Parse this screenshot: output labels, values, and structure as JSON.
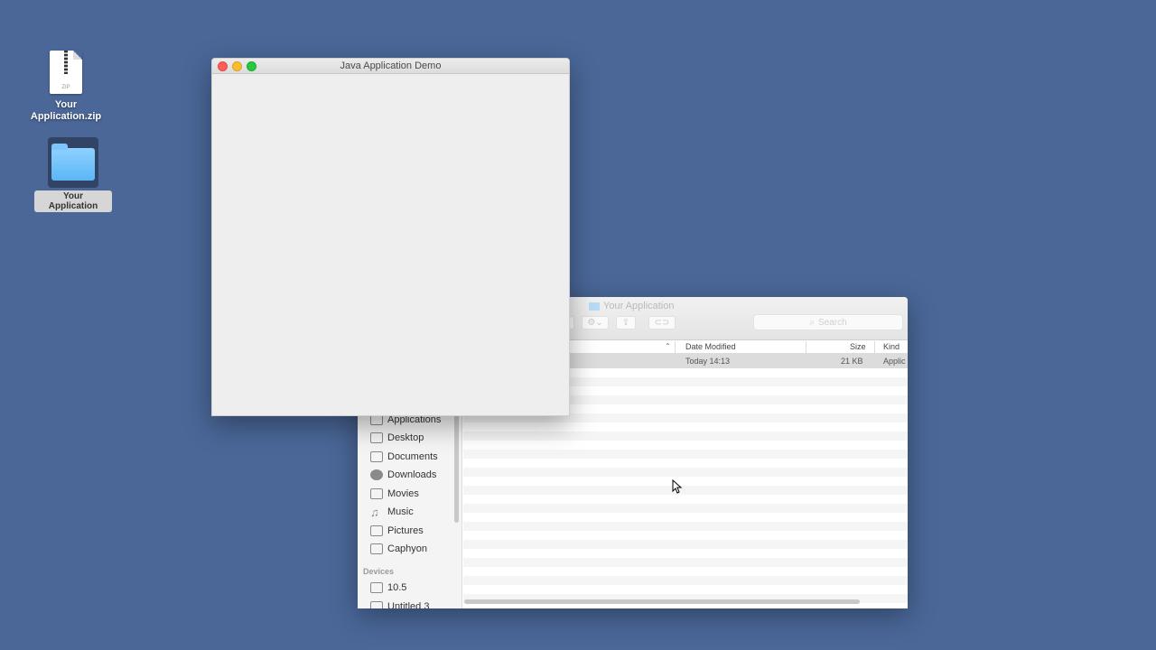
{
  "desktop": {
    "zip_file": {
      "label": "Your Application.zip",
      "badge": "ZIP"
    },
    "folder": {
      "label": "Your Application"
    }
  },
  "java_window": {
    "title": "Java Application Demo"
  },
  "finder": {
    "title": "Your Application",
    "search_placeholder": "Search",
    "columns": {
      "date_modified": "Date Modified",
      "size": "Size",
      "kind": "Kind"
    },
    "selected_row": {
      "date": "Today 14:13",
      "size": "21 KB",
      "kind": "Applic"
    },
    "sidebar": {
      "items": [
        {
          "label": "Applications",
          "icon": "applications-icon"
        },
        {
          "label": "Desktop",
          "icon": "desktop-icon"
        },
        {
          "label": "Documents",
          "icon": "documents-icon"
        },
        {
          "label": "Downloads",
          "icon": "downloads-icon"
        },
        {
          "label": "Movies",
          "icon": "movies-icon"
        },
        {
          "label": "Music",
          "icon": "music-icon"
        },
        {
          "label": "Pictures",
          "icon": "pictures-icon"
        },
        {
          "label": "Caphyon",
          "icon": "folder-icon"
        }
      ],
      "devices_header": "Devices",
      "devices": [
        {
          "label": "10.5",
          "icon": "disk-icon"
        },
        {
          "label": "Untitled 3",
          "icon": "disk-icon"
        }
      ]
    }
  }
}
